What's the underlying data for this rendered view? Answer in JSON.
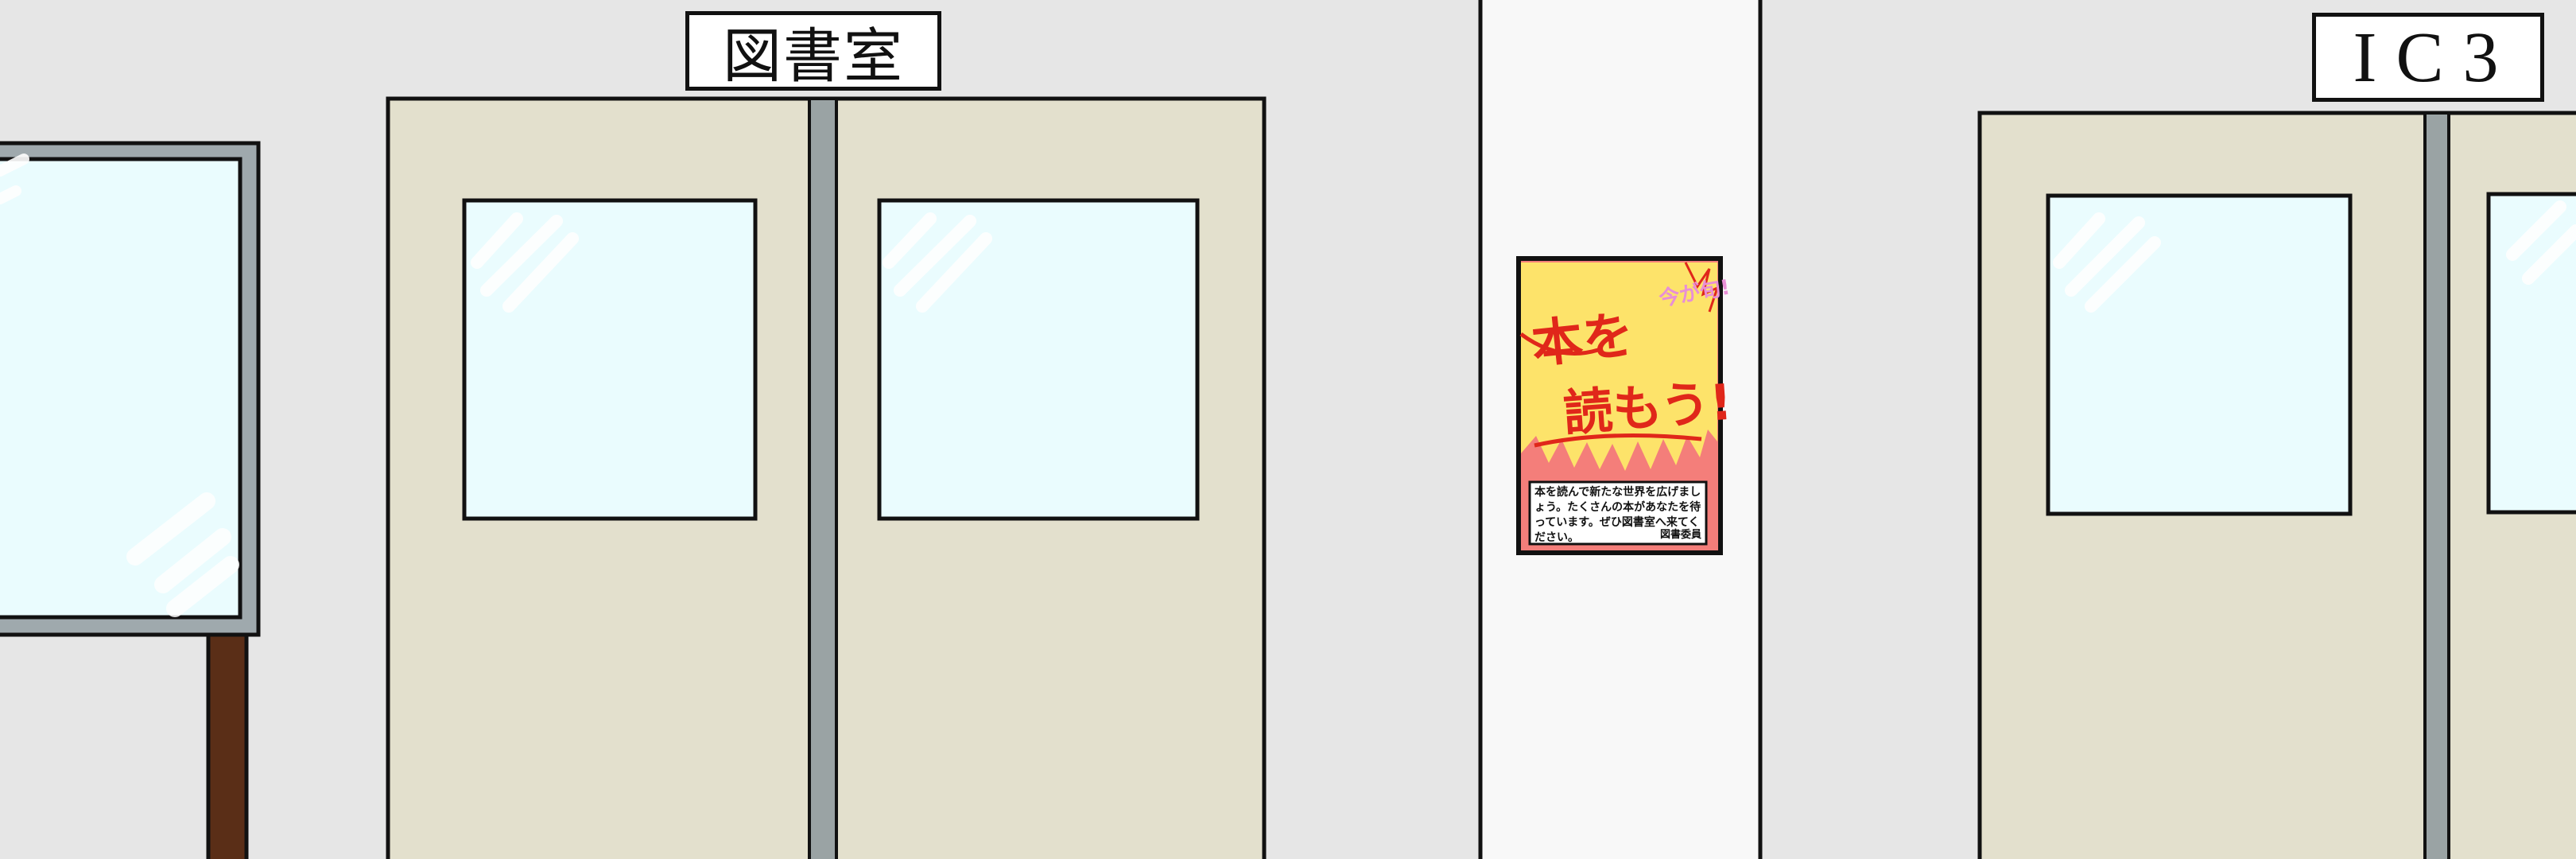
{
  "scene": {
    "library_sign": "図書室",
    "room_sign": "IC3",
    "poster": {
      "headline_1": "本を",
      "headline_2": "読もう!",
      "corner_note": "今が旬!",
      "body_text": "本を読んで新たな世界を広げましょう。たくさんの本があなたを待っています。ぜひ図書室へ来てください。",
      "signature": "図書委員"
    }
  },
  "colors": {
    "wall": "#e6e6e6",
    "pillar": "#f8f8f8",
    "door": "#e3e0cd",
    "door_glass": "#eafcfe",
    "door_seam": "#9aa3a4",
    "board_frame": "#9fa9ad",
    "board_post": "#5a2e17",
    "poster_bg": "#f47e7a",
    "poster_yellow": "#fde36a",
    "poster_red": "#e0271a",
    "outline": "#111111"
  }
}
